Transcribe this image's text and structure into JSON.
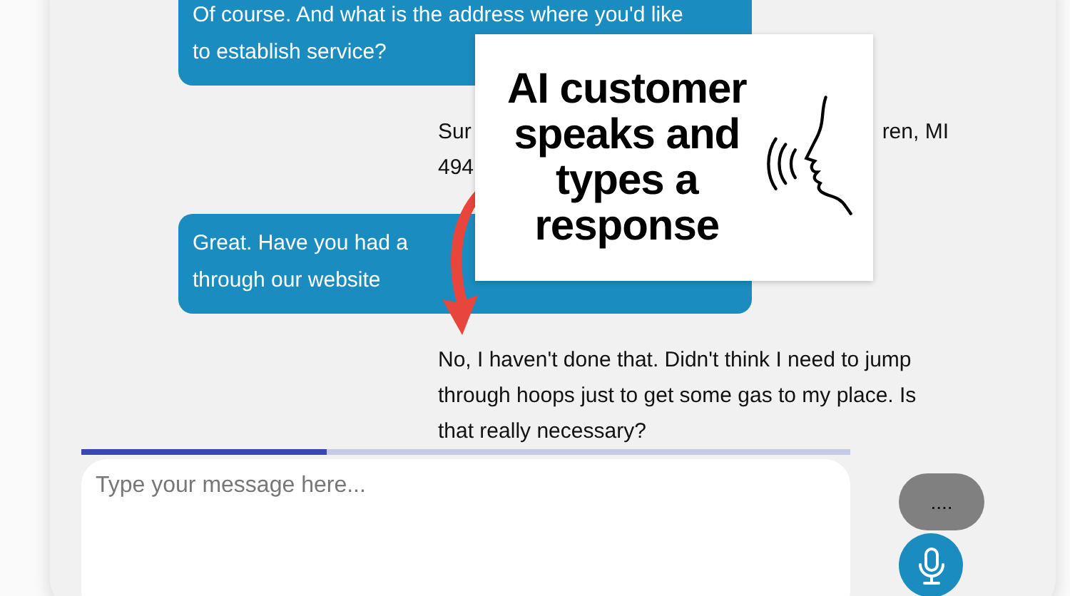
{
  "messages": [
    {
      "kind": "agent",
      "lines": [
        [
          "Of course. And what is the address where you'd like"
        ],
        [
          "to establish service?"
        ]
      ]
    },
    {
      "kind": "customer",
      "lines": [
        [
          "Sur",
          "ren, MI"
        ],
        [
          "494"
        ]
      ]
    },
    {
      "kind": "agent",
      "lines": [
        [
          "Great. Have you had a"
        ],
        [
          "through our website"
        ]
      ]
    },
    {
      "kind": "customer",
      "lines": [
        [
          "No, I haven't done that. Didn't think I need to jump"
        ],
        [
          "through hoops just to get some gas to my place. Is"
        ],
        [
          "that really necessary?"
        ]
      ]
    }
  ],
  "callout": {
    "text": "AI customer speaks and types a response"
  },
  "composer": {
    "progress": {
      "level": 0.32
    },
    "placeholder": "Type your message here...",
    "typing_indicator": "...."
  }
}
